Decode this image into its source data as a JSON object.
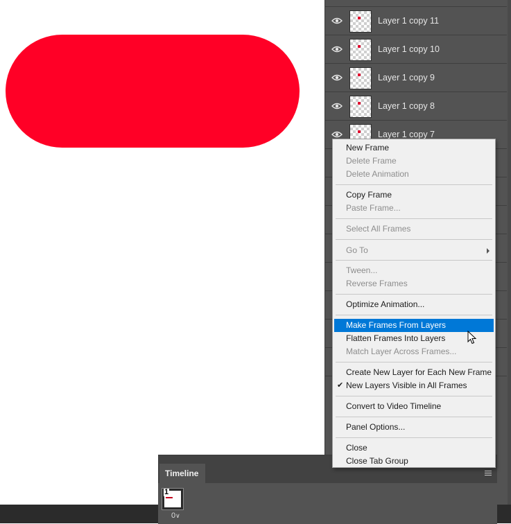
{
  "colors": {
    "shape_fill": "#ff0026",
    "panel_bg": "#535353",
    "menu_bg": "#f0f0f0",
    "highlight": "#0078d7"
  },
  "layers": [
    {
      "name": "Layer 1 copy 11",
      "icon": "eye-icon"
    },
    {
      "name": "Layer 1 copy 10",
      "icon": "eye-icon"
    },
    {
      "name": "Layer 1 copy 9",
      "icon": "eye-icon"
    },
    {
      "name": "Layer 1 copy 8",
      "icon": "eye-icon"
    },
    {
      "name": "Layer 1 copy 7",
      "icon": "eye-icon"
    }
  ],
  "menu": {
    "new_frame": "New Frame",
    "delete_frame": "Delete Frame",
    "delete_animation": "Delete Animation",
    "copy_frame": "Copy Frame",
    "paste_frame": "Paste Frame...",
    "select_all_frames": "Select All Frames",
    "go_to": "Go To",
    "tween": "Tween...",
    "reverse_frames": "Reverse Frames",
    "optimize_animation": "Optimize Animation...",
    "make_frames_from_layers": "Make Frames From Layers",
    "flatten_frames": "Flatten Frames Into Layers",
    "match_layer": "Match Layer Across Frames...",
    "create_new_layer": "Create New Layer for Each New Frame",
    "new_layers_visible": "New Layers Visible in All Frames",
    "convert_video": "Convert to Video Timeline",
    "panel_options": "Panel Options...",
    "close": "Close",
    "close_tab_group": "Close Tab Group"
  },
  "timeline": {
    "tab_label": "Timeline",
    "frame_number": "1",
    "frame_delay": "0"
  }
}
